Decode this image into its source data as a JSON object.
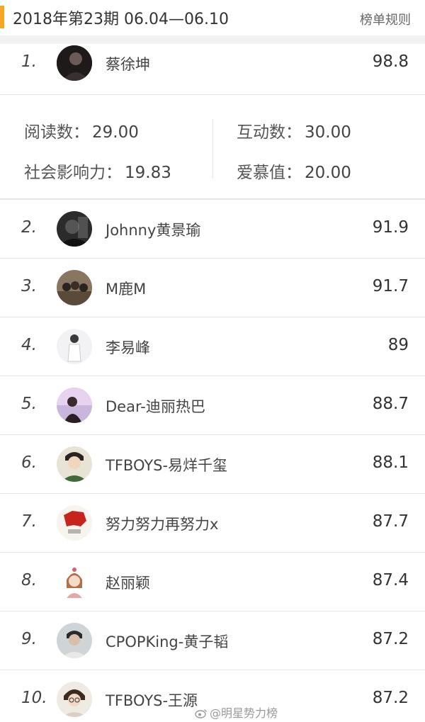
{
  "header": {
    "title": "2018年第23期  06.04—06.10",
    "rules_link": "榜单规则",
    "accent_color": "#f5a623"
  },
  "first_entry": {
    "rank": "1.",
    "name": "蔡徐坤",
    "score": "98.8",
    "avatar_icon": "avatar-photo"
  },
  "detail": {
    "reads_label": "阅读数：",
    "reads_value": "29.00",
    "interaction_label": "互动数：",
    "interaction_value": "30.00",
    "influence_label": "社会影响力：",
    "influence_value": "19.83",
    "love_label": "爱慕值：",
    "love_value": "20.00"
  },
  "entries": [
    {
      "rank": "2.",
      "name": "Johnny黄景瑜",
      "score": "91.9"
    },
    {
      "rank": "3.",
      "name": "M鹿M",
      "score": "91.7"
    },
    {
      "rank": "4.",
      "name": "李易峰",
      "score": "89"
    },
    {
      "rank": "5.",
      "name": "Dear-迪丽热巴",
      "score": "88.7"
    },
    {
      "rank": "6.",
      "name": "TFBOYS-易烊千玺",
      "score": "88.1"
    },
    {
      "rank": "7.",
      "name": "努力努力再努力x",
      "score": "87.7"
    },
    {
      "rank": "8.",
      "name": "赵丽颖",
      "score": "87.4"
    },
    {
      "rank": "9.",
      "name": "CPOPKing-黄子韬",
      "score": "87.2"
    },
    {
      "rank": "10.",
      "name": "TFBOYS-王源",
      "score": "87.2"
    }
  ],
  "watermark": {
    "text": "@明星势力榜",
    "icon": "weibo-logo-icon"
  }
}
